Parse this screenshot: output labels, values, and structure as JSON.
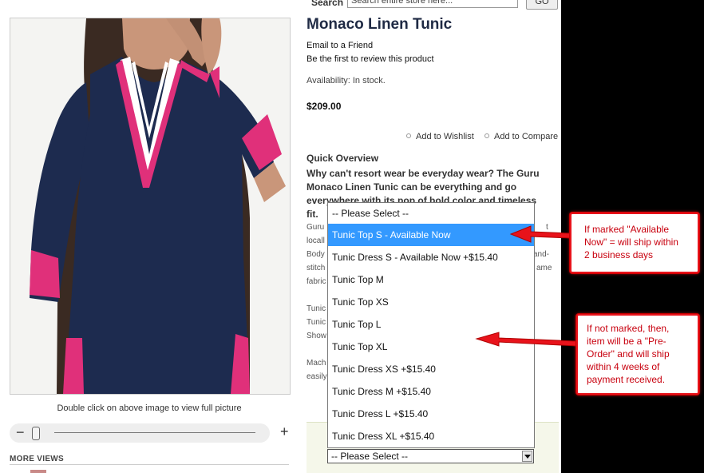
{
  "search": {
    "label": "Search",
    "placeholder": "Search entire store here...",
    "button_label": "GO"
  },
  "product": {
    "title": "Monaco Linen Tunic",
    "email_friend": "Email to a Friend",
    "first_review": "Be the first to review this product",
    "availability": "Availability: In stock.",
    "price": "$209.00",
    "add_to_wishlist": "Add to Wishlist",
    "add_to_compare": "Add to Compare"
  },
  "overview": {
    "heading": "Quick Overview",
    "bold_lines": [
      "Why can't resort wear be everyday wear? The Guru",
      "Monaco Linen Tunic can be everything and go",
      "everywhere with its pop of bold color and timeless fit."
    ],
    "partial_left": [
      "Guru",
      "locall",
      "Body",
      "stitch",
      "fabric",
      "Tunic",
      "Tunic",
      "Show",
      "Mach",
      "easily"
    ],
    "partial_right": [
      "t",
      "and-",
      "ame"
    ]
  },
  "image_panel": {
    "zoom_hint": "Double click on above image to view  full picture",
    "zoom_out_label": "−",
    "zoom_in_label": "+",
    "more_views_label": "MORE VIEWS",
    "zoom_level": 0
  },
  "size_select": {
    "selected_label": "-- Please Select --",
    "highlighted_index": 1,
    "options": [
      "-- Please Select --",
      "Tunic Top S - Available Now",
      "Tunic Dress S - Available Now +$15.40",
      "Tunic Top M",
      "Tunic Top XS",
      "Tunic Top L",
      "Tunic Top XL",
      "Tunic Dress XS +$15.40",
      "Tunic Dress M +$15.40",
      "Tunic Dress L +$15.40",
      "Tunic Dress XL +$15.40"
    ]
  },
  "annotations": {
    "callout_1": [
      "If marked \"Available",
      "Now\" = will ship within",
      "2 business days"
    ],
    "callout_2": [
      "If not marked, then,",
      "item will be a \"Pre-",
      "Order\" and will ship",
      "within 4 weeks of",
      "payment received."
    ]
  },
  "colors": {
    "tunic_navy": "#1d2b4f",
    "trim_pink": "#e0307a",
    "highlight_blue": "#3399ff",
    "annotation_red": "#e8131b"
  },
  "icons": [
    "model-photo",
    "zoom-slider-handle",
    "bullet-icon",
    "select-arrow-icon",
    "red-arrow-icon"
  ]
}
